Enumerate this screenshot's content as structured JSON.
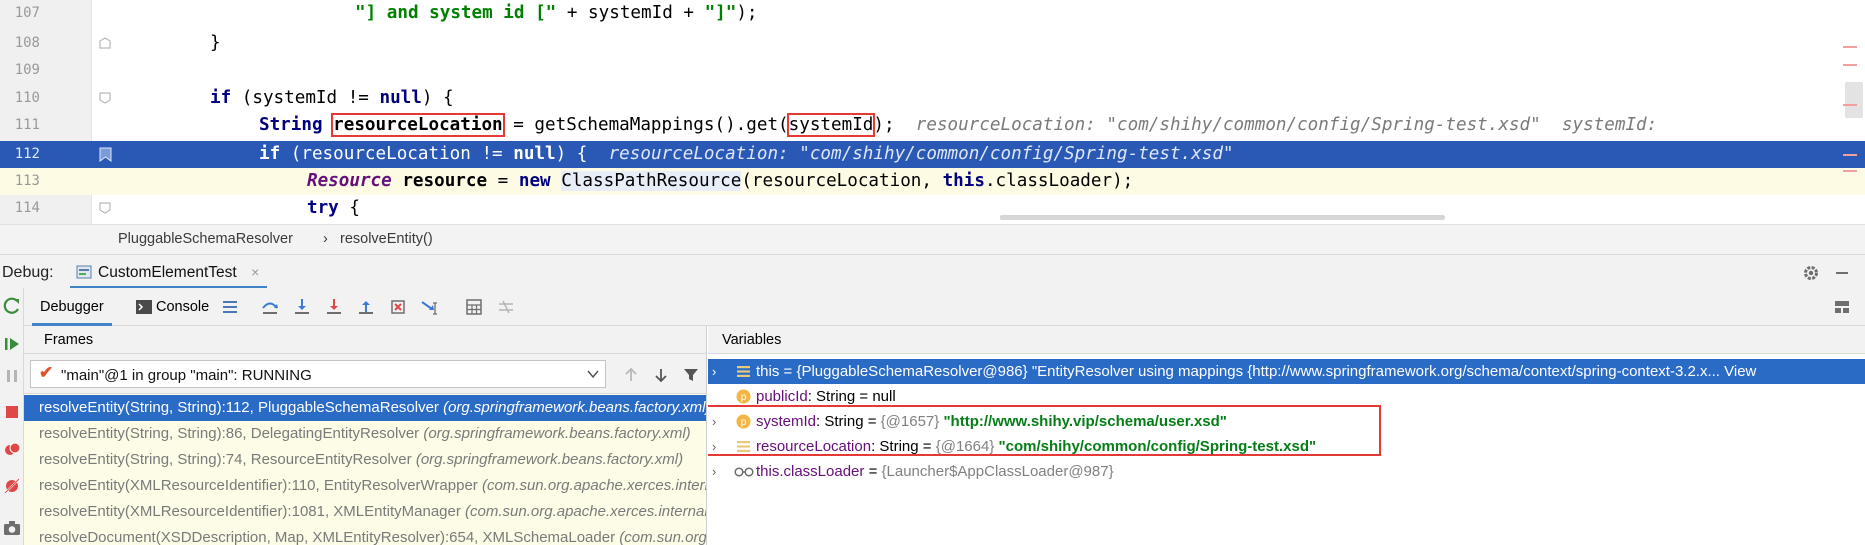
{
  "editor": {
    "lines": [
      {
        "num": "107",
        "text": "\"] and system id [\" + systemId + \"]\");"
      },
      {
        "num": "108",
        "text": "}"
      },
      {
        "num": "109",
        "text": ""
      },
      {
        "num": "110",
        "text": "if (systemId != null) {"
      },
      {
        "num": "111",
        "text": "String resourceLocation = getSchemaMappings().get(systemId);",
        "hint": "resourceLocation: \"com/shihy/common/config/Spring-test.xsd\"  systemId:"
      },
      {
        "num": "112",
        "text": "if (resourceLocation != null) {",
        "hint": "resourceLocation: \"com/shihy/common/config/Spring-test.xsd\""
      },
      {
        "num": "113",
        "text": "Resource resource = new ClassPathResource(resourceLocation, this.classLoader);"
      },
      {
        "num": "114",
        "text": "try {"
      }
    ],
    "tokens": {
      "l107_a": "\"] and system id [\"",
      "l107_b": " + systemId + ",
      "l107_c": "\"]\"",
      "l107_d": ");",
      "l108": "}",
      "l110_kw": "if",
      "l110_a": " (systemId != ",
      "l110_null": "null",
      "l110_b": ") {",
      "l111_type": "String",
      "l111_sp": " ",
      "l111_var": "resourceLocation",
      "l111_a": " = getSchemaMappings().get(",
      "l111_arg": "systemId",
      "l111_b": ");",
      "l111_hint": "resourceLocation: \"com/shihy/common/config/Spring-test.xsd\"  systemId:",
      "l112_kw": "if",
      "l112_a": " (resourceLocation != ",
      "l112_null": "null",
      "l112_b": ") {",
      "l112_hint": "resourceLocation: \"com/shihy/common/config/Spring-test.xsd\"",
      "l113_type": "Resource",
      "l113_var": " resource",
      "l113_a": " = ",
      "l113_new": "new",
      "l113_sp": " ",
      "l113_cls": "ClassPathResource",
      "l113_b": "(resourceLocation, ",
      "l113_this": "this",
      "l113_c": ".classLoader);",
      "l114_kw": "try",
      "l114_a": " {"
    }
  },
  "breadcrumb": {
    "class": "PluggableSchemaResolver",
    "sep": "›",
    "method": "resolveEntity()"
  },
  "debug": {
    "label": "Debug:",
    "session_tab": "CustomElementTest",
    "close": "×",
    "tabs": {
      "debugger": "Debugger",
      "console": "Console"
    }
  },
  "frames": {
    "title": "Frames",
    "thread": "\"main\"@1 in group \"main\": RUNNING",
    "check": "✔",
    "items": [
      {
        "sig": "resolveEntity(String, String):112, PluggableSchemaResolver ",
        "pkg": "(org.springframework.beans.factory.xml)"
      },
      {
        "sig": "resolveEntity(String, String):86, DelegatingEntityResolver ",
        "pkg": "(org.springframework.beans.factory.xml)"
      },
      {
        "sig": "resolveEntity(String, String):74, ResourceEntityResolver ",
        "pkg": "(org.springframework.beans.factory.xml)"
      },
      {
        "sig": "resolveEntity(XMLResourceIdentifier):110, EntityResolverWrapper ",
        "pkg": "(com.sun.org.apache.xerces.internal.util)"
      },
      {
        "sig": "resolveEntity(XMLResourceIdentifier):1081, XMLEntityManager ",
        "pkg": "(com.sun.org.apache.xerces.internal.impl)"
      },
      {
        "sig": "resolveDocument(XSDDescription, Map, XMLEntityResolver):654, XMLSchemaLoader ",
        "pkg": "(com.sun.org.apache.xerces.internal.impl.xs)"
      }
    ]
  },
  "variables": {
    "title": "Variables",
    "items": [
      {
        "arrow": "›",
        "name": "this",
        "eq": " = ",
        "ref": "{PluggableSchemaResolver@986}",
        "value": " \"EntityResolver using mappings {http://www.springframework.org/schema/context/spring-context-3.2.x... View",
        "icon": "field"
      },
      {
        "arrow": "",
        "name": "publicId",
        "type": ": String",
        "eq": "  = ",
        "value": "null",
        "icon": "param"
      },
      {
        "arrow": "›",
        "name": "systemId",
        "type": ": String",
        "eq": "  = ",
        "ref": "{@1657}",
        "value": " \"http://www.shihy.vip/schema/user.xsd\"",
        "icon": "param"
      },
      {
        "arrow": "›",
        "name": "resourceLocation",
        "type": ": String",
        "eq": "  = ",
        "ref": "{@1664}",
        "value": " \"com/shihy/common/config/Spring-test.xsd\"",
        "icon": "field"
      },
      {
        "arrow": "›",
        "name": "this.classLoader",
        "eq": " = ",
        "ref": "{Launcher$AppClassLoader@987}",
        "value": "",
        "icon": "oo"
      }
    ]
  },
  "colors": {
    "exec_line": "#2a59b5",
    "current_line": "#fdfbe4",
    "selection": "#2a6bc6",
    "keyword": "#000080",
    "string": "#008000",
    "annotation_box": "#e53935"
  }
}
